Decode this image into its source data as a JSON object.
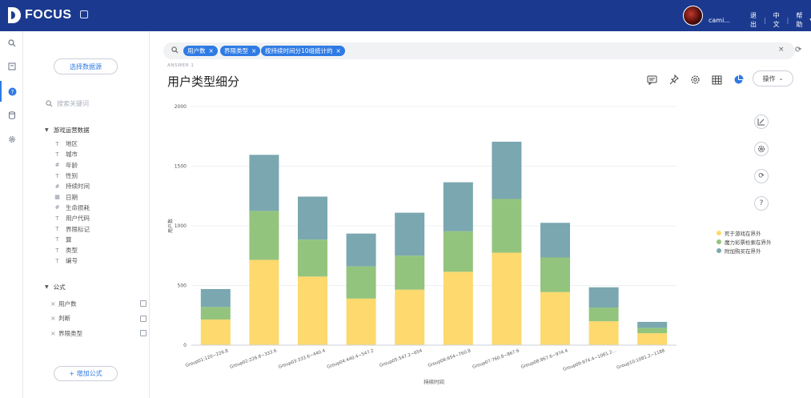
{
  "app": {
    "logo_text": "FOCUS"
  },
  "topbar": {
    "user_name": "cami...",
    "logout": "退出",
    "language": "中文",
    "help": "帮助"
  },
  "sidebar": {
    "select_source_label": "选择数据源",
    "search_placeholder": "搜索关键词",
    "dataset_title": "游戏运营数据",
    "fields": [
      {
        "icon": "text-field-icon",
        "label": "地区"
      },
      {
        "icon": "text-field-icon",
        "label": "城市"
      },
      {
        "icon": "number-field-icon",
        "label": "年龄"
      },
      {
        "icon": "text-field-icon",
        "label": "性别"
      },
      {
        "icon": "number-field-icon",
        "label": "持续时间"
      },
      {
        "icon": "date-field-icon",
        "label": "日期"
      },
      {
        "icon": "number-field-icon",
        "label": "生命损耗"
      },
      {
        "icon": "text-field-icon",
        "label": "用户代码"
      },
      {
        "icon": "text-field-icon",
        "label": "界限标记"
      },
      {
        "icon": "text-field-icon",
        "label": "算"
      },
      {
        "icon": "text-field-icon",
        "label": "类型"
      },
      {
        "icon": "text-field-icon",
        "label": "编号"
      }
    ],
    "formula_title": "公式",
    "formulas": [
      {
        "label": "用户数"
      },
      {
        "label": "判断"
      },
      {
        "label": "界限类型"
      }
    ],
    "add_formula_label": "+ 增加公式"
  },
  "query": {
    "tags": [
      "用户数",
      "界限类型",
      "按持续时间分10组统计的"
    ]
  },
  "answer": {
    "label": "ANSWER 1",
    "title": "用户类型细分",
    "operate_label": "操作"
  },
  "colors": {
    "yellow": "#fdd96e",
    "green": "#93c47d",
    "teal": "#7aa7b0"
  },
  "chart_data": {
    "type": "bar",
    "stacked": true,
    "xlabel": "持续时间",
    "ylabel": "用户数",
    "ylim": [
      0,
      2000
    ],
    "yticks": [
      0,
      500,
      1000,
      1500,
      2000
    ],
    "categories": [
      "Group01:120~226.8",
      "Group02:226.8~333.6",
      "Group03:333.6~440.4",
      "Group04:440.4~547.2",
      "Group05:547.2~654",
      "Group06:654~760.8",
      "Group07:760.8~867.6",
      "Group08:867.6~974.4",
      "Group09:974.4~1081.2...",
      "Group10:1081.2~1188"
    ],
    "series": [
      {
        "name": "死于游戏在界外",
        "color": "#fdd96e",
        "values": [
          215,
          715,
          575,
          390,
          465,
          615,
          775,
          445,
          200,
          100
        ]
      },
      {
        "name": "魔力彩票检索在界外",
        "color": "#93c47d",
        "values": [
          105,
          410,
          310,
          270,
          285,
          340,
          450,
          290,
          115,
          45
        ]
      },
      {
        "name": "附加购买在界外",
        "color": "#7aa7b0",
        "values": [
          150,
          470,
          360,
          275,
          360,
          410,
          480,
          290,
          170,
          50
        ]
      }
    ],
    "legend_position": "right",
    "grid": true
  }
}
